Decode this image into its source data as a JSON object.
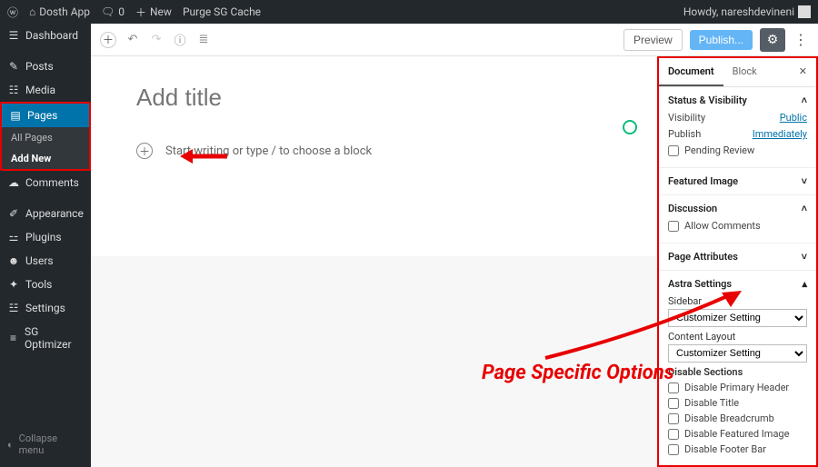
{
  "adminbar": {
    "site_name": "Dosth App",
    "comments_count": "0",
    "new_label": "New",
    "purge_label": "Purge SG Cache",
    "howdy": "Howdy, nareshdevineni"
  },
  "sidebar": {
    "items": [
      {
        "icon": "🏠",
        "label": "Dashboard"
      },
      {
        "icon": "📌",
        "label": "Posts"
      },
      {
        "icon": "🖼",
        "label": "Media"
      },
      {
        "icon": "📄",
        "label": "Pages"
      },
      {
        "icon": "💬",
        "label": "Comments"
      },
      {
        "icon": "🎨",
        "label": "Appearance"
      },
      {
        "icon": "🔌",
        "label": "Plugins"
      },
      {
        "icon": "👤",
        "label": "Users"
      },
      {
        "icon": "🔧",
        "label": "Tools"
      },
      {
        "icon": "⚙",
        "label": "Settings"
      },
      {
        "icon": "⚡",
        "label": "SG Optimizer"
      }
    ],
    "submenu": {
      "all": "All Pages",
      "add": "Add New"
    },
    "collapse": "Collapse menu"
  },
  "toolbar": {
    "preview": "Preview",
    "publish": "Publish..."
  },
  "canvas": {
    "title_placeholder": "Add title",
    "body_placeholder": "Start writing or type / to choose a block"
  },
  "settings": {
    "tabs": {
      "document": "Document",
      "block": "Block"
    },
    "status": {
      "title": "Status & Visibility",
      "visibility_label": "Visibility",
      "visibility_value": "Public",
      "publish_label": "Publish",
      "publish_value": "Immediately",
      "pending": "Pending Review"
    },
    "featured": {
      "title": "Featured Image"
    },
    "discussion": {
      "title": "Discussion",
      "allow": "Allow Comments"
    },
    "attributes": {
      "title": "Page Attributes"
    },
    "astra": {
      "title": "Astra Settings",
      "sidebar_label": "Sidebar",
      "sidebar_value": "Customizer Setting",
      "layout_label": "Content Layout",
      "layout_value": "Customizer Setting",
      "disable_title": "Disable Sections",
      "opts": [
        "Disable Primary Header",
        "Disable Title",
        "Disable Breadcrumb",
        "Disable Featured Image",
        "Disable Footer Bar"
      ]
    }
  },
  "annotation": "Page Specific Options"
}
